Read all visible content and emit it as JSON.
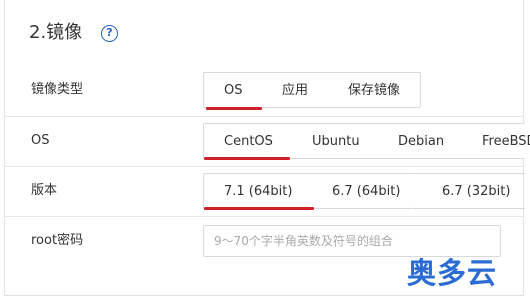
{
  "section": {
    "title": "2.镜像",
    "help_icon": "question-circle-icon"
  },
  "image_type": {
    "label": "镜像类型",
    "options": [
      "OS",
      "应用",
      "保存镜像"
    ],
    "selected": "OS"
  },
  "os": {
    "label": "OS",
    "options": [
      "CentOS",
      "Ubuntu",
      "Debian",
      "FreeBSD"
    ],
    "selected": "CentOS"
  },
  "version": {
    "label": "版本",
    "options": [
      "7.1 (64bit)",
      "6.7 (64bit)",
      "6.7 (32bit)"
    ],
    "selected": "7.1 (64bit)"
  },
  "root_password": {
    "label": "root密码",
    "placeholder": "9～70个字半角英数及符号的组合",
    "value": ""
  },
  "watermark": "奥多云",
  "colors": {
    "accent": "#d0202a",
    "help": "#2a63c4",
    "border": "#d9d9d9"
  }
}
